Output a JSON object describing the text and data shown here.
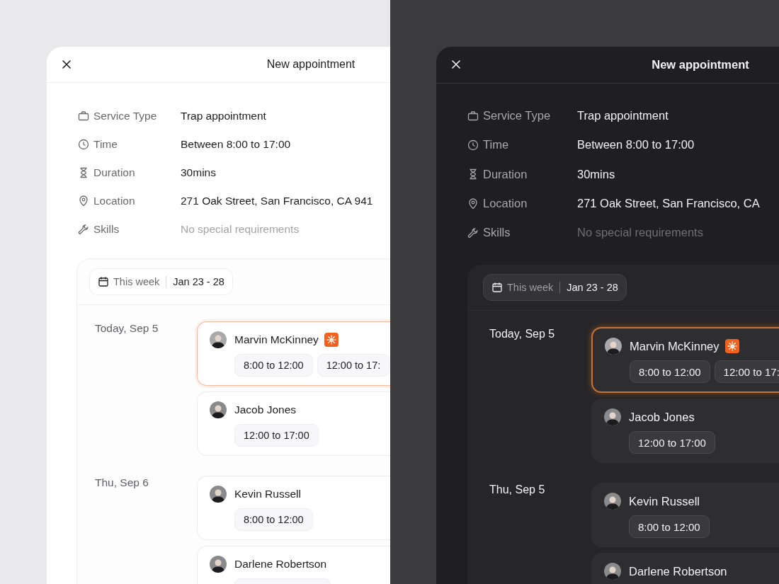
{
  "panels": [
    {
      "kind": "light",
      "title": "New appointment",
      "details": [
        {
          "kind": "service",
          "label": "Service Type",
          "value": "Trap appointment",
          "muted": false
        },
        {
          "kind": "time",
          "label": "Time",
          "value": "Between 8:00 to 17:00",
          "muted": false
        },
        {
          "kind": "duration",
          "label": "Duration",
          "value": "30mins",
          "muted": false
        },
        {
          "kind": "location",
          "label": "Location",
          "value": "271 Oak Street, San Francisco, CA 941",
          "muted": false
        },
        {
          "kind": "skills",
          "label": "Skills",
          "value": "No special requirements",
          "muted": true
        }
      ],
      "week": {
        "label": "This week",
        "range": "Jan 23 - 28"
      },
      "days": [
        {
          "date": "Today, Sep 5",
          "people": [
            {
              "name": "Marvin McKinney",
              "selected": true,
              "badge": true,
              "slots": [
                "8:00 to 12:00",
                "12:00 to 17:"
              ]
            },
            {
              "name": "Jacob Jones",
              "selected": false,
              "badge": false,
              "slots": [
                "12:00 to 17:00"
              ]
            }
          ]
        },
        {
          "date": "Thu, Sep 6",
          "people": [
            {
              "name": "Kevin Russell",
              "selected": false,
              "badge": false,
              "slots": [
                "8:00 to 12:00"
              ]
            },
            {
              "name": "Darlene Robertson",
              "selected": false,
              "badge": false
            }
          ]
        }
      ]
    },
    {
      "kind": "dark",
      "title": "New appointment",
      "details": [
        {
          "kind": "service",
          "label": "Service Type",
          "value": "Trap appointment",
          "muted": false
        },
        {
          "kind": "time",
          "label": "Time",
          "value": "Between 8:00 to 17:00",
          "muted": false
        },
        {
          "kind": "duration",
          "label": "Duration",
          "value": "30mins",
          "muted": false
        },
        {
          "kind": "location",
          "label": "Location",
          "value": "271 Oak Street, San Francisco, CA",
          "muted": false
        },
        {
          "kind": "skills",
          "label": "Skills",
          "value": "No special requirements",
          "muted": true
        }
      ],
      "week": {
        "label": "This week",
        "range": "Jan 23 - 28"
      },
      "days": [
        {
          "date": "Today, Sep 5",
          "people": [
            {
              "name": "Marvin McKinney",
              "selected": true,
              "badge": true,
              "slots": [
                "8:00 to 12:00",
                "12:00 to 17:"
              ]
            },
            {
              "name": "Jacob Jones",
              "selected": false,
              "badge": false,
              "slots": [
                "12:00 to 17:00"
              ]
            }
          ]
        },
        {
          "date": "Thu, Sep 5",
          "people": [
            {
              "name": "Kevin Russell",
              "selected": false,
              "badge": false,
              "slots": [
                "8:00 to 12:00"
              ]
            },
            {
              "name": "Darlene Robertson",
              "selected": false,
              "badge": false
            }
          ]
        }
      ]
    }
  ]
}
